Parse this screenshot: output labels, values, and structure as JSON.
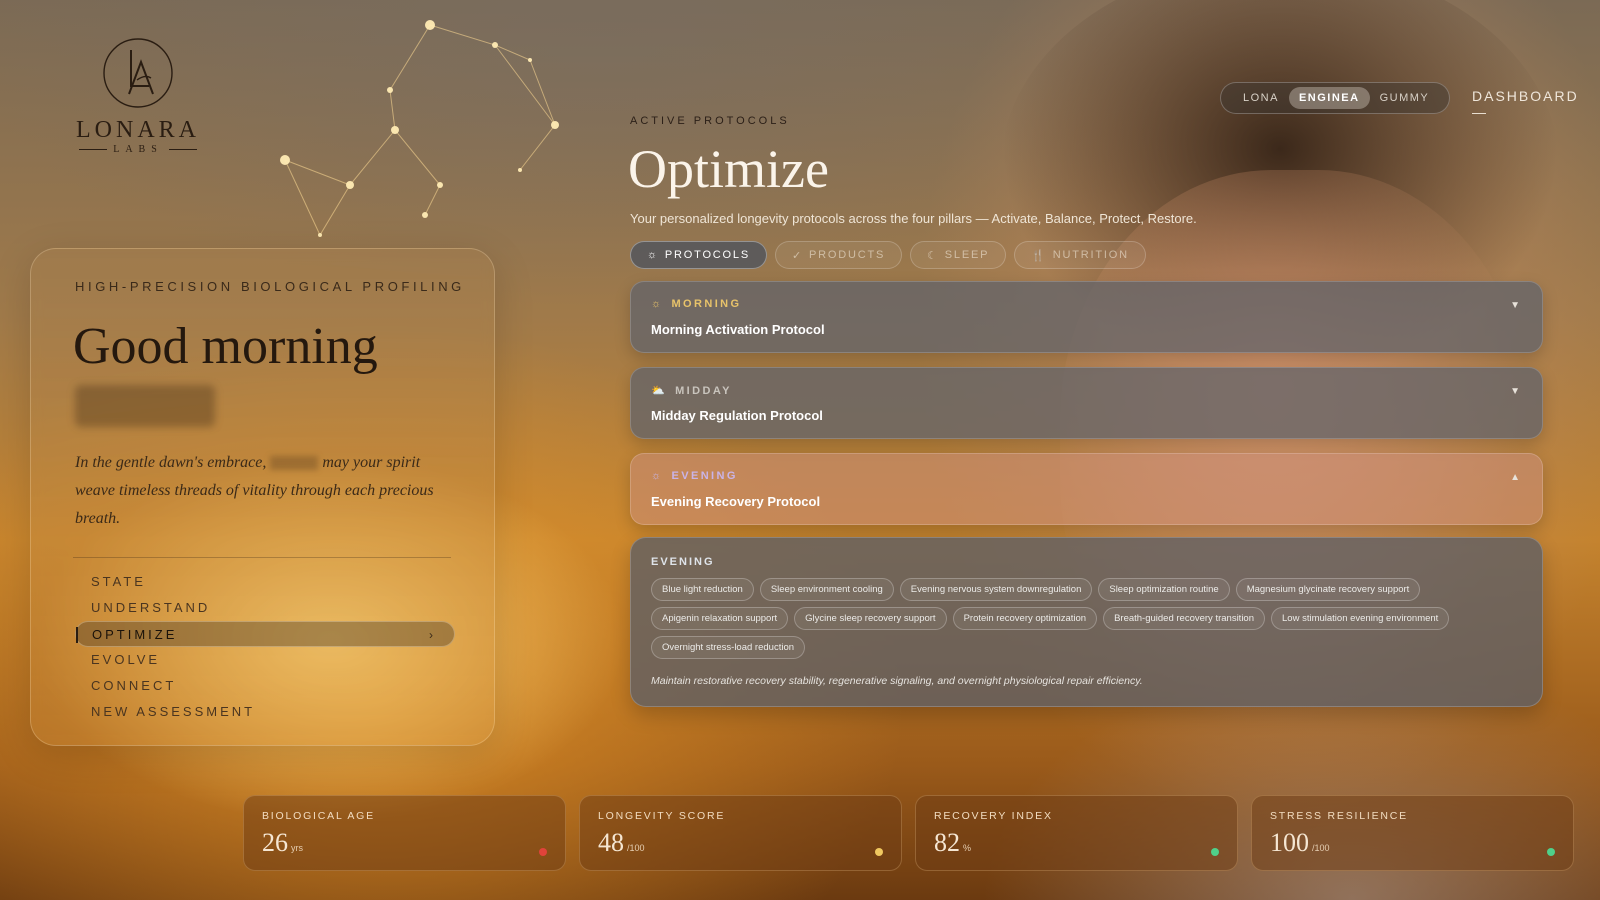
{
  "brand": {
    "name": "LONARA",
    "sub": "LABS"
  },
  "profile": {
    "eyebrow": "HIGH-PRECISION BIOLOGICAL PROFILING",
    "greeting": "Good morning",
    "blessing_pre": "In the gentle dawn's embrace,",
    "blessing_post": "may your spirit weave timeless threads of vitality through each precious breath."
  },
  "nav": {
    "items": [
      {
        "label": "STATE"
      },
      {
        "label": "UNDERSTAND"
      },
      {
        "label": "OPTIMIZE"
      },
      {
        "label": "EVOLVE"
      },
      {
        "label": "CONNECT"
      },
      {
        "label": "NEW ASSESSMENT"
      }
    ],
    "active_index": 2
  },
  "brand_toggle": {
    "options": [
      "LONA",
      "ENGINEA",
      "GUMMY"
    ],
    "selected": "ENGINEA"
  },
  "header": {
    "dashboard": "DASHBOARD —"
  },
  "main": {
    "eyebrow": "ACTIVE PROTOCOLS",
    "title": "Optimize",
    "subtitle": "Your personalized longevity protocols across the four pillars — Activate, Balance, Protect, Restore.",
    "tabs": [
      {
        "label": "PROTOCOLS",
        "icon": "sun-icon"
      },
      {
        "label": "PRODUCTS",
        "icon": "check-icon"
      },
      {
        "label": "SLEEP",
        "icon": "moon-icon"
      },
      {
        "label": "NUTRITION",
        "icon": "utensils-icon"
      }
    ],
    "active_tab": "PROTOCOLS"
  },
  "protocols": [
    {
      "time": "MORNING",
      "name": "Morning Activation Protocol",
      "icon": "sun-icon",
      "color": "#e8c36a",
      "expanded": false
    },
    {
      "time": "MIDDAY",
      "name": "Midday Regulation Protocol",
      "icon": "sunrise-icon",
      "color": "#c9c4bd",
      "expanded": false
    },
    {
      "time": "EVENING",
      "name": "Evening Recovery Protocol",
      "icon": "sun-icon",
      "color": "#c9b4e8",
      "expanded": true
    }
  ],
  "evening_detail": {
    "title": "EVENING",
    "chips": [
      "Blue light reduction",
      "Sleep environment cooling",
      "Evening nervous system downregulation",
      "Sleep optimization routine",
      "Magnesium glycinate recovery support",
      "Apigenin relaxation support",
      "Glycine sleep recovery support",
      "Protein recovery optimization",
      "Breath-guided recovery transition",
      "Low stimulation evening environment",
      "Overnight stress-load reduction"
    ],
    "note": "Maintain restorative recovery stability, regenerative signaling, and overnight physiological repair efficiency."
  },
  "metrics": [
    {
      "label": "BIOLOGICAL AGE",
      "value": "26",
      "unit": "yrs",
      "status_color": "#e0433a"
    },
    {
      "label": "LONGEVITY SCORE",
      "value": "48",
      "unit": "/100",
      "status_color": "#f0c860"
    },
    {
      "label": "RECOVERY INDEX",
      "value": "82",
      "unit": "%",
      "status_color": "#4fd08a"
    },
    {
      "label": "STRESS RESILIENCE",
      "value": "100",
      "unit": "/100",
      "status_color": "#4fd08a"
    }
  ]
}
